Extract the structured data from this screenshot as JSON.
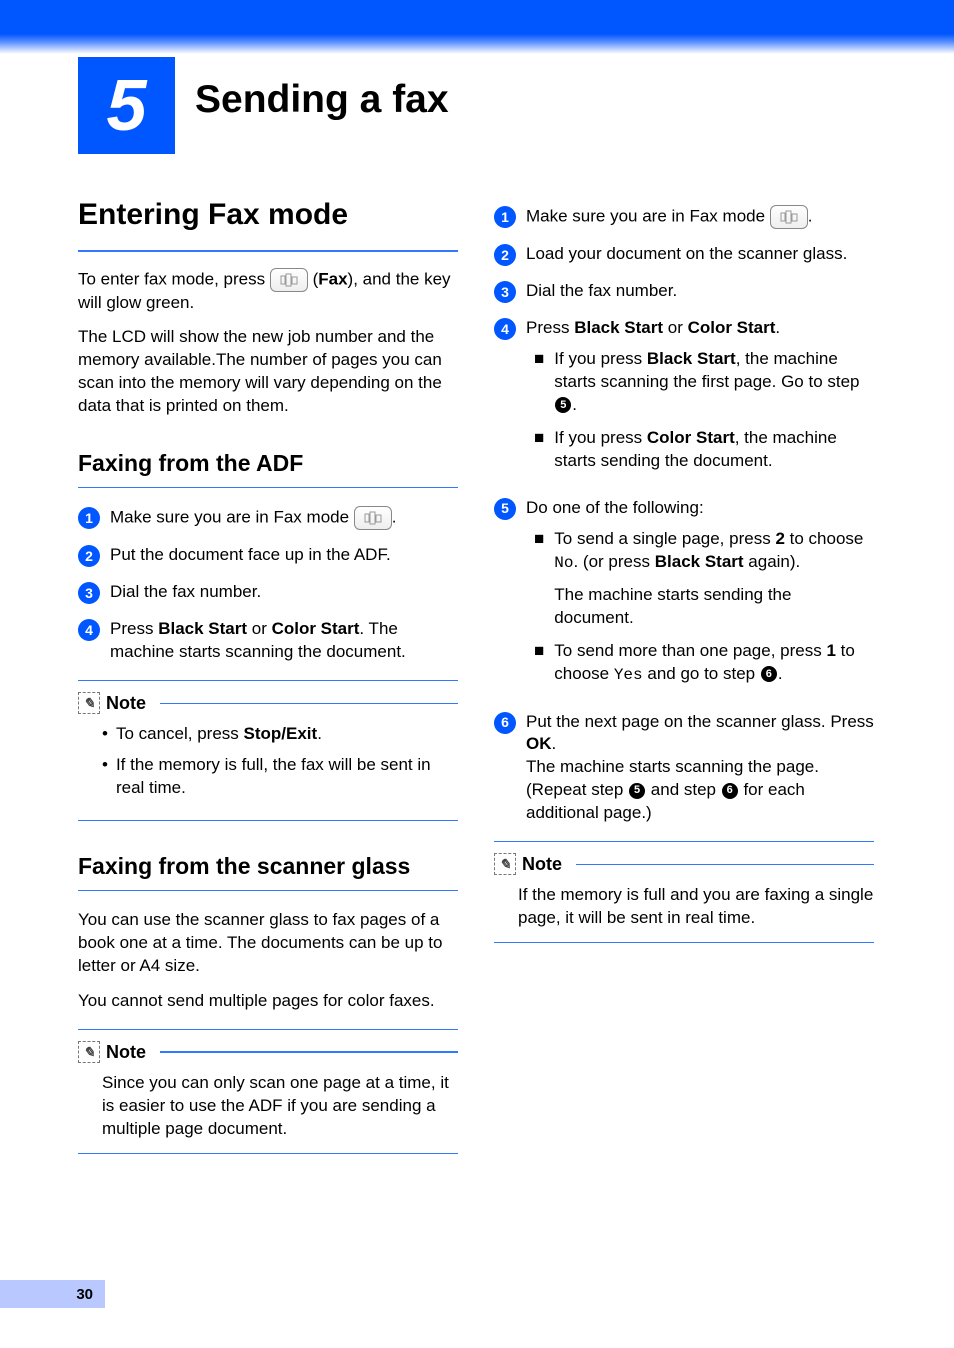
{
  "chapter": {
    "number": "5",
    "title": "Sending a fax"
  },
  "left": {
    "h2": "Entering Fax mode",
    "p1a": "To enter fax mode, press ",
    "p1b": " (",
    "p1c_bold": "Fax",
    "p1d": "), and the key will glow green.",
    "p2": "The LCD will show the new job number and the memory available.The number of pages you can scan into the memory will vary depending on the data that is printed on them.",
    "h3a": "Faxing from the ADF",
    "adf": {
      "s1": "Make sure you are in Fax mode ",
      "s1b": ".",
      "s2": "Put the document face up in the ADF.",
      "s3": "Dial the fax number.",
      "s4a": "Press ",
      "s4b": "Black Start",
      "s4c": " or ",
      "s4d": "Color Start",
      "s4e": ". The machine starts scanning the document."
    },
    "note1": {
      "label": "Note",
      "b1a": "To cancel, press ",
      "b1b": "Stop/Exit",
      "b1c": ".",
      "b2": "If the memory is full, the fax will be sent in real time."
    },
    "h3b": "Faxing from the scanner glass",
    "p3": "You can use the scanner glass to fax pages of a book one at a time. The documents can be up to letter or A4 size.",
    "p4": "You cannot send multiple pages for color faxes.",
    "note2": {
      "label": "Note",
      "body": "Since you can only scan one page at a time, it is easier to use the ADF if you are sending a multiple page document."
    }
  },
  "right": {
    "s1a": "Make sure you are in Fax mode ",
    "s1b": ".",
    "s2": "Load your document on the scanner glass.",
    "s3": "Dial the fax number.",
    "s4a": "Press ",
    "s4b": "Black Start",
    "s4c": " or ",
    "s4d": "Color Start",
    "s4e": ".",
    "s4f1": "If you press ",
    "s4f2": "Black Start",
    "s4f3": ", the machine starts scanning the first page. Go to step ",
    "s4f4": ".",
    "s4g1": "If you press ",
    "s4g2": "Color Start",
    "s4g3": ", the machine starts sending the document.",
    "s5": "Do one of the following:",
    "s5a1": "To send a single page, press ",
    "s5a2": "2",
    "s5a3": " to choose ",
    "s5a4": "No",
    "s5a5": ". (or press ",
    "s5a6": "Black Start",
    "s5a7": " again).",
    "s5a8": "The machine starts sending the document.",
    "s5b1": "To send more than one page, press ",
    "s5b2": "1",
    "s5b3": " to choose ",
    "s5b4": "Yes",
    "s5b5": " and go to step ",
    "s5b6": ".",
    "s6a": "Put the next page on the scanner glass. Press ",
    "s6b": "OK",
    "s6c": ".",
    "s6d": "The machine starts scanning the page. (Repeat step ",
    "s6e": " and step ",
    "s6f": " for each additional page.)",
    "note": {
      "label": "Note",
      "body": "If the memory is full and you are faxing a single page, it will be sent in real time."
    }
  },
  "page_num": "30"
}
